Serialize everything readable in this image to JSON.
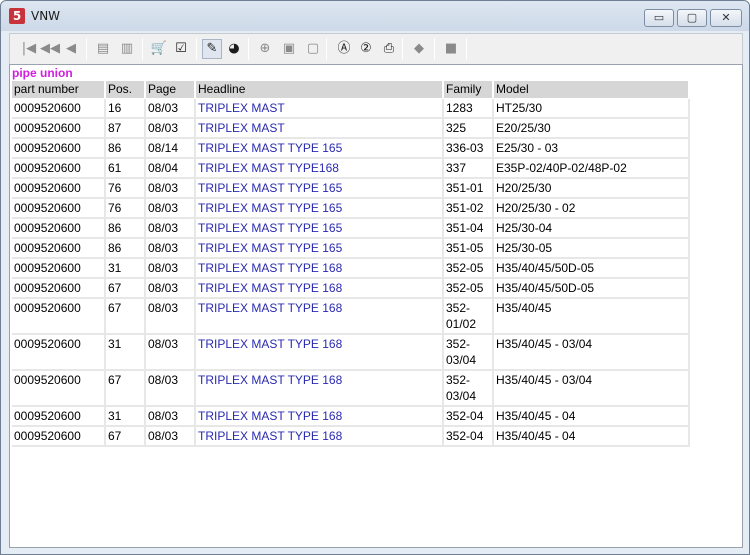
{
  "window": {
    "title": "VNW",
    "app_icon_text": "5",
    "minimize_label": "▭",
    "maximize_label": "▢",
    "close_label": "✕"
  },
  "toolbar": {
    "buttons": [
      {
        "name": "first-icon",
        "glyph": "|◀",
        "enabled": false
      },
      {
        "name": "previous-fast-icon",
        "glyph": "◀◀",
        "enabled": false
      },
      {
        "name": "previous-icon",
        "glyph": "◀",
        "enabled": false
      },
      {
        "name": "document-back-icon",
        "glyph": "▤",
        "enabled": false
      },
      {
        "name": "document-forward-icon",
        "glyph": "▥",
        "enabled": false
      },
      {
        "name": "cart-icon",
        "glyph": "🛒",
        "enabled": true
      },
      {
        "name": "checklist-icon",
        "glyph": "☑",
        "enabled": true
      },
      {
        "name": "pencil-icon",
        "glyph": "✎",
        "enabled": true
      },
      {
        "name": "globe-icon",
        "glyph": "◕",
        "enabled": true
      },
      {
        "name": "zoom-icon",
        "glyph": "⊕",
        "enabled": false
      },
      {
        "name": "page-icon",
        "glyph": "▣",
        "enabled": false
      },
      {
        "name": "page-fit-icon",
        "glyph": "▢",
        "enabled": false
      },
      {
        "name": "search-a-icon",
        "glyph": "Ⓐ",
        "enabled": true
      },
      {
        "name": "search-2-icon",
        "glyph": "②",
        "enabled": true
      },
      {
        "name": "print-icon",
        "glyph": "⎙",
        "enabled": true
      },
      {
        "name": "eraser-icon",
        "glyph": "◆",
        "enabled": false
      },
      {
        "name": "stop-icon",
        "glyph": "■",
        "enabled": false
      }
    ]
  },
  "caption": "pipe union",
  "table": {
    "headers": {
      "part": "part number",
      "pos": "Pos.",
      "page": "Page",
      "headline": "Headline",
      "family": "Family",
      "model": "Model"
    },
    "rows": [
      {
        "part": "0009520600",
        "pos": "16",
        "page": "08/03",
        "headline": "TRIPLEX MAST",
        "family": "1283",
        "model": "HT25/30"
      },
      {
        "part": "0009520600",
        "pos": "87",
        "page": "08/03",
        "headline": "TRIPLEX MAST",
        "family": "325",
        "model": "E20/25/30"
      },
      {
        "part": "0009520600",
        "pos": "86",
        "page": "08/14",
        "headline": "TRIPLEX MAST TYPE 165",
        "family": "336-03",
        "model": "E25/30 - 03"
      },
      {
        "part": "0009520600",
        "pos": "61",
        "page": "08/04",
        "headline": "TRIPLEX MAST TYPE168",
        "family": "337",
        "model": "E35P-02/40P-02/48P-02"
      },
      {
        "part": "0009520600",
        "pos": "76",
        "page": "08/03",
        "headline": "TRIPLEX MAST TYPE 165",
        "family": "351-01",
        "model": "H20/25/30"
      },
      {
        "part": "0009520600",
        "pos": "76",
        "page": "08/03",
        "headline": "TRIPLEX MAST TYPE 165",
        "family": "351-02",
        "model": "H20/25/30 - 02"
      },
      {
        "part": "0009520600",
        "pos": "86",
        "page": "08/03",
        "headline": "TRIPLEX MAST TYPE 165",
        "family": "351-04",
        "model": "H25/30-04"
      },
      {
        "part": "0009520600",
        "pos": "86",
        "page": "08/03",
        "headline": "TRIPLEX MAST TYPE 165",
        "family": "351-05",
        "model": "H25/30-05"
      },
      {
        "part": "0009520600",
        "pos": "31",
        "page": "08/03",
        "headline": "TRIPLEX MAST TYPE 168",
        "family": "352-05",
        "model": "H35/40/45/50D-05"
      },
      {
        "part": "0009520600",
        "pos": "67",
        "page": "08/03",
        "headline": "TRIPLEX MAST TYPE 168",
        "family": "352-05",
        "model": "H35/40/45/50D-05"
      },
      {
        "part": "0009520600",
        "pos": "67",
        "page": "08/03",
        "headline": "TRIPLEX MAST TYPE 168",
        "family": "352-01/02",
        "model": "H35/40/45"
      },
      {
        "part": "0009520600",
        "pos": "31",
        "page": "08/03",
        "headline": "TRIPLEX MAST TYPE 168",
        "family": "352-03/04",
        "model": "H35/40/45 - 03/04"
      },
      {
        "part": "0009520600",
        "pos": "67",
        "page": "08/03",
        "headline": "TRIPLEX MAST TYPE 168",
        "family": "352-03/04",
        "model": "H35/40/45 - 03/04"
      },
      {
        "part": "0009520600",
        "pos": "31",
        "page": "08/03",
        "headline": "TRIPLEX MAST TYPE 168",
        "family": "352-04",
        "model": "H35/40/45 - 04"
      },
      {
        "part": "0009520600",
        "pos": "67",
        "page": "08/03",
        "headline": "TRIPLEX MAST TYPE 168",
        "family": "352-04",
        "model": "H35/40/45 - 04"
      }
    ]
  },
  "colors": {
    "caption": "#d21ee0",
    "headline_link": "#2a2ab0",
    "header_bg": "#d6d6d6"
  }
}
